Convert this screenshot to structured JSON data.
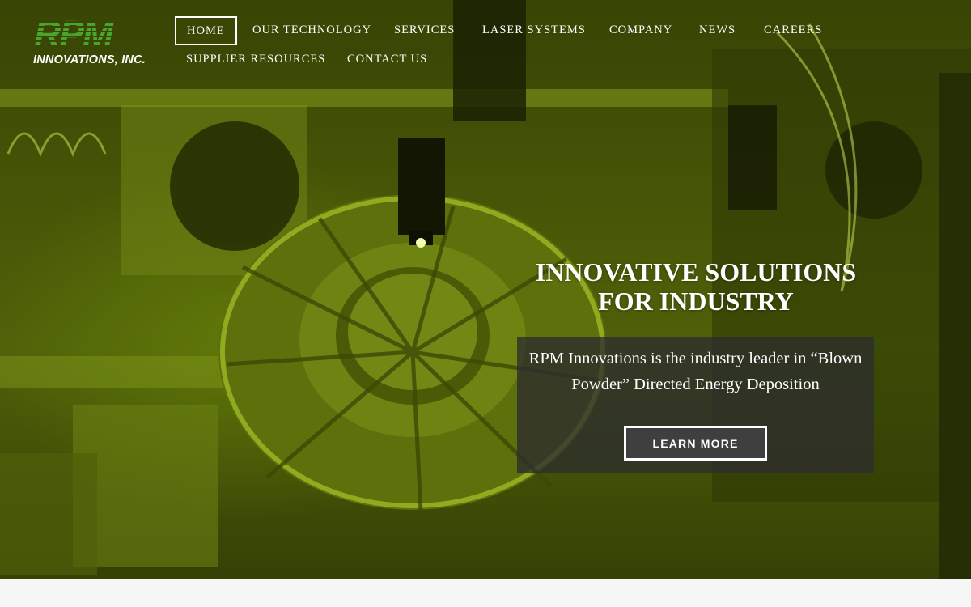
{
  "brand": {
    "logo_mark_text": "RPM",
    "logo_subtext": "INNOVATIONS, INC.",
    "logo_color": "#4aa52e"
  },
  "nav": {
    "items": [
      {
        "label": "HOME",
        "active": true
      },
      {
        "label": "OUR TECHNOLOGY"
      },
      {
        "label": "SERVICES"
      },
      {
        "label": "LASER SYSTEMS"
      },
      {
        "label": "COMPANY"
      },
      {
        "label": "NEWS"
      },
      {
        "label": "CAREERS"
      },
      {
        "label": "SUPPLIER RESOURCES"
      },
      {
        "label": "CONTACT US"
      }
    ]
  },
  "hero": {
    "headline_line1": "INNOVATIVE SOLUTIONS",
    "headline_line2": "FOR INDUSTRY",
    "description": "RPM Innovations is the industry leader in “Blown Powder” Directed Energy Deposition",
    "cta_label": "LEARN MORE",
    "tint_color": "#5a6e0a"
  }
}
